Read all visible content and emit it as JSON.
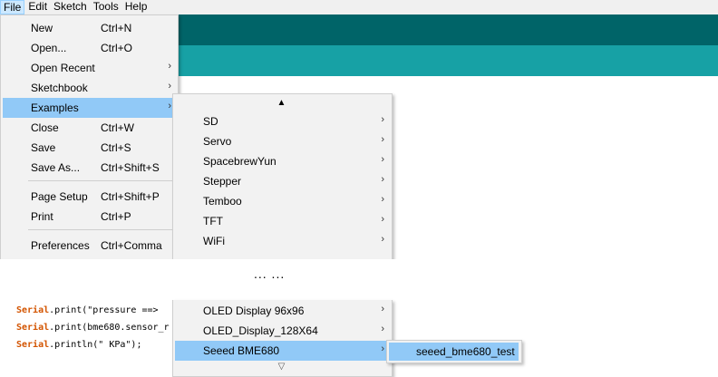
{
  "menubar": {
    "items": [
      "File",
      "Edit",
      "Sketch",
      "Tools",
      "Help"
    ]
  },
  "file_menu": {
    "items": [
      {
        "label": "New",
        "shortcut": "Ctrl+N"
      },
      {
        "label": "Open...",
        "shortcut": "Ctrl+O"
      },
      {
        "label": "Open Recent",
        "submenu": "›"
      },
      {
        "label": "Sketchbook",
        "submenu": "›"
      },
      {
        "label": "Examples",
        "submenu": "›",
        "highlighted": true
      },
      {
        "label": "Close",
        "shortcut": "Ctrl+W"
      },
      {
        "label": "Save",
        "shortcut": "Ctrl+S"
      },
      {
        "label": "Save As...",
        "shortcut": "Ctrl+Shift+S"
      },
      {
        "label": "Page Setup",
        "shortcut": "Ctrl+Shift+P"
      },
      {
        "label": "Print",
        "shortcut": "Ctrl+P"
      },
      {
        "label": "Preferences",
        "shortcut": "Ctrl+Comma"
      }
    ]
  },
  "examples_menu": {
    "scroll_up": "▲",
    "scroll_down": "▽",
    "arrow": "›",
    "items": [
      "SD",
      "Servo",
      "SpacebrewYun",
      "Stepper",
      "Temboo",
      "TFT",
      "WiFi"
    ],
    "items_bottom": [
      "OLED Display 96x96",
      "OLED_Display_128X64",
      "Seeed BME680"
    ]
  },
  "ellipsis": "... ...",
  "submenu": {
    "items": [
      "seeed_bme680_test"
    ]
  },
  "editor": {
    "lines": [
      {
        "kw": "Serial",
        "rest": ".print(\"pressure ==>"
      },
      {
        "kw": "Serial",
        "rest": ".print(bme680.sensor_r"
      },
      {
        "kw": "Serial",
        "rest": ".println(\" KPa\");"
      }
    ]
  },
  "colors": {
    "toolbar_dark": "#006468",
    "toolbar_light": "#17a1a5",
    "highlight": "#91c9f7",
    "keyword": "#d35400"
  }
}
